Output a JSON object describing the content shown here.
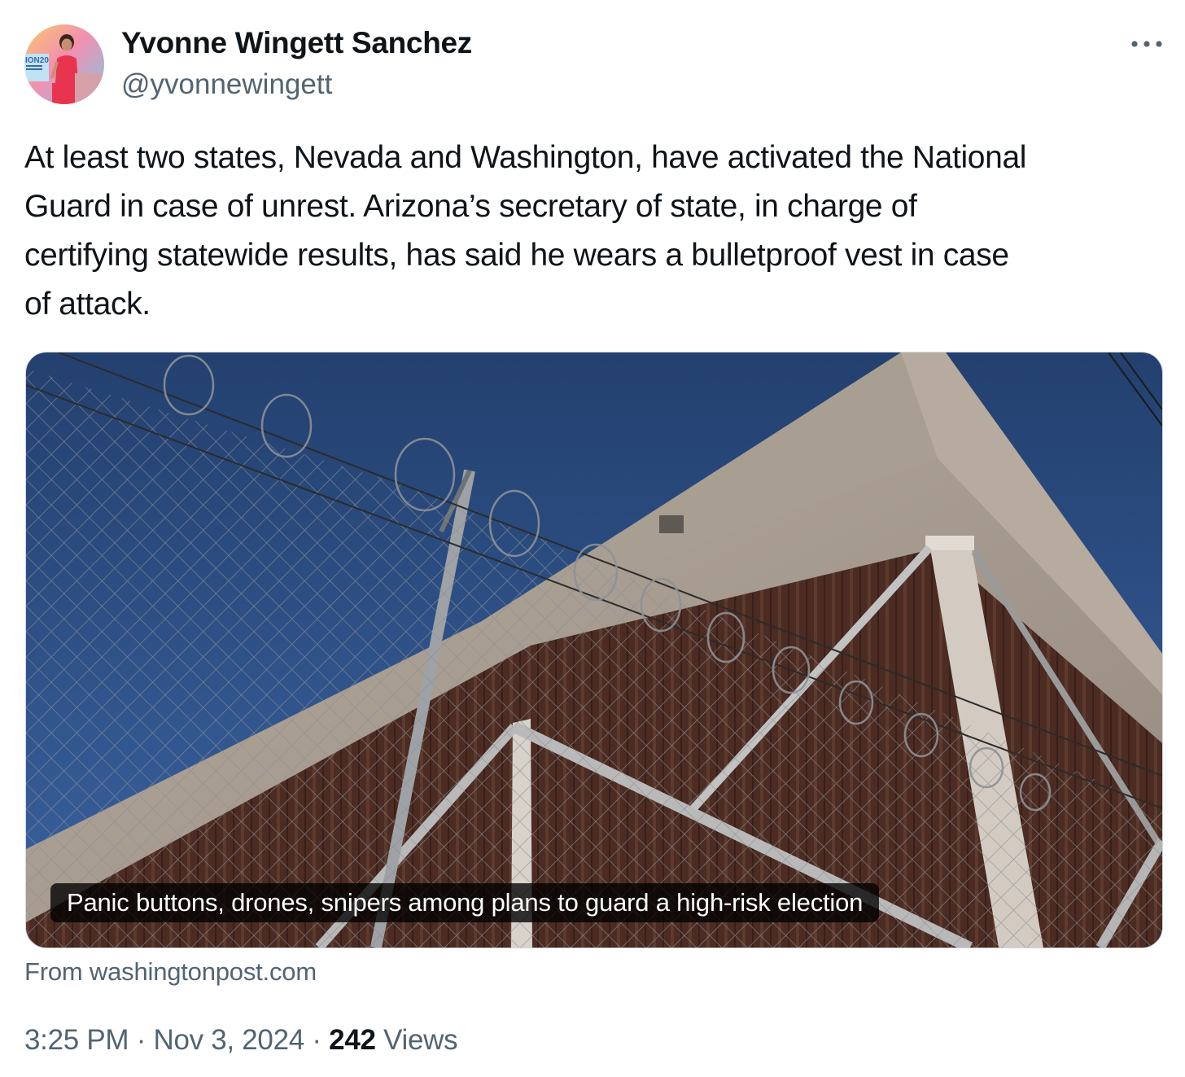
{
  "author": {
    "display_name": "Yvonne Wingett Sanchez",
    "handle": "@yvonnewingett",
    "avatar_badge_text": "ION20"
  },
  "tweet": {
    "text": "At least two states, Nevada and Washington, have activated the National\nGuard in case of unrest. Arizona’s secretary of state, in charge of\ncertifying statewide results, has said he wears a bulletproof vest in case\nof attack."
  },
  "link_card": {
    "caption": "Panic buttons, drones, snipers among plans to guard a high-risk election",
    "source": "From washingtonpost.com"
  },
  "meta": {
    "time": "3:25 PM",
    "separator": "·",
    "date": "Nov 3, 2024",
    "views_count": "242",
    "views_label": "Views"
  },
  "icons": {
    "more": "more-horizontal-icon"
  },
  "colors": {
    "text_primary": "#0f1419",
    "text_secondary": "#536471",
    "border": "#cfd9de",
    "sky": "#2c4a7c",
    "wall": "#a79c91",
    "siding": "#4a2c24"
  }
}
